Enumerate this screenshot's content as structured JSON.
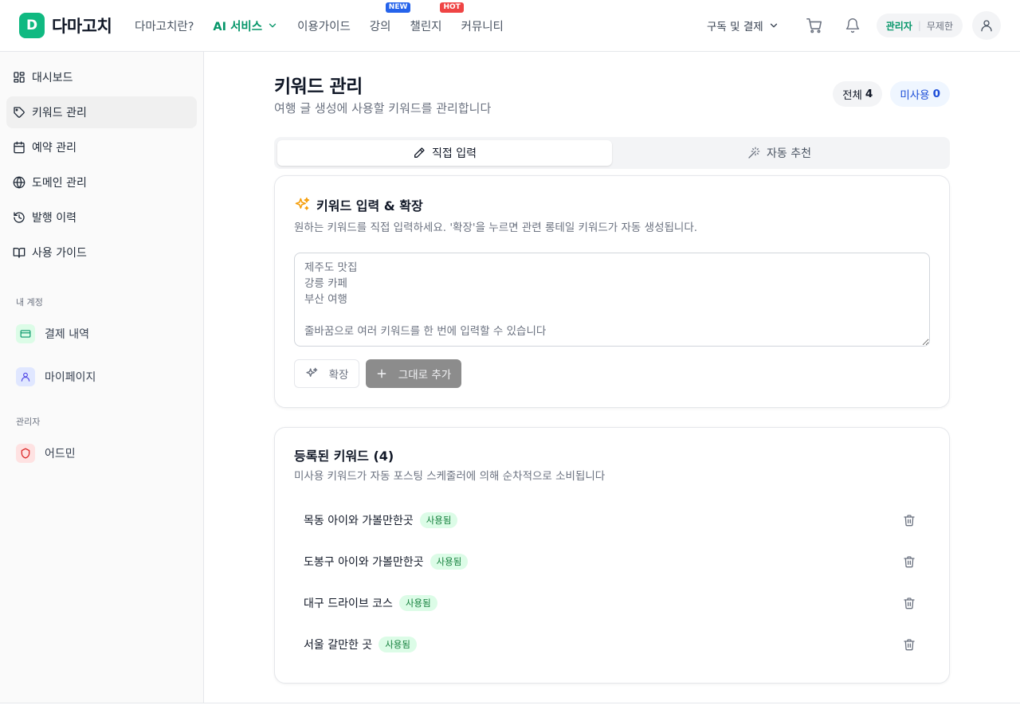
{
  "brand": {
    "logo_letter": "D",
    "name": "다마고치"
  },
  "nav": {
    "items": [
      {
        "label": "다마고치란?"
      },
      {
        "label": "AI 서비스"
      },
      {
        "label": "이용가이드"
      },
      {
        "label": "강의",
        "badge": "NEW"
      },
      {
        "label": "챌린지",
        "badge": "HOT"
      },
      {
        "label": "커뮤니티"
      }
    ]
  },
  "header_right": {
    "subscription_label": "구독 및 결제",
    "role": "관리자",
    "plan": "무제한"
  },
  "sidebar": {
    "items": [
      {
        "label": "대시보드",
        "icon": "dashboard-icon"
      },
      {
        "label": "키워드 관리",
        "icon": "tag-icon"
      },
      {
        "label": "예약 관리",
        "icon": "calendar-icon"
      },
      {
        "label": "도메인 관리",
        "icon": "globe-icon"
      },
      {
        "label": "발행 이력",
        "icon": "history-icon"
      },
      {
        "label": "사용 가이드",
        "icon": "book-icon"
      }
    ],
    "account_section": "내 계정",
    "account_items": [
      {
        "label": "결제 내역",
        "icon": "credit-card-icon"
      },
      {
        "label": "마이페이지",
        "icon": "user-icon"
      }
    ],
    "admin_section": "관리자",
    "admin_items": [
      {
        "label": "어드민",
        "icon": "shield-icon"
      }
    ]
  },
  "page": {
    "title": "키워드 관리",
    "subtitle": "여행 글 생성에 사용할 키워드를 관리합니다",
    "stats": {
      "total_label": "전체",
      "total_value": "4",
      "unused_label": "미사용",
      "unused_value": "0"
    }
  },
  "tabs": [
    {
      "label": "직접 입력",
      "active": true
    },
    {
      "label": "자동 추천",
      "active": false
    }
  ],
  "input_card": {
    "title": "키워드 입력 & 확장",
    "description": "원하는 키워드를 직접 입력하세요. '확장'을 누르면 관련 롱테일 키워드가 자동 생성됩니다.",
    "placeholder": "제주도 맛집\n강릉 카페\n부산 여행\n\n줄바꿈으로 여러 키워드를 한 번에 입력할 수 있습니다",
    "expand_label": "확장",
    "add_label": "그대로 추가"
  },
  "list_card": {
    "title": "등록된 키워드 (4)",
    "description": "미사용 키워드가 자동 포스팅 스케줄러에 의해 순차적으로 소비됩니다",
    "keywords": [
      {
        "text": "목동 아이와 가볼만한곳",
        "status": "사용됨"
      },
      {
        "text": "도봉구 아이와 가볼만한곳",
        "status": "사용됨"
      },
      {
        "text": "대구 드라이브 코스",
        "status": "사용됨"
      },
      {
        "text": "서울 갈만한 곳",
        "status": "사용됨"
      }
    ]
  },
  "colors": {
    "brand": "#10b981",
    "active_nav": "#059669",
    "badge_new": "#2563eb",
    "badge_hot": "#ef4444",
    "used_badge_bg": "#dcfce7",
    "used_badge_text": "#15803d",
    "unused_stat": "#1d4ed8"
  }
}
